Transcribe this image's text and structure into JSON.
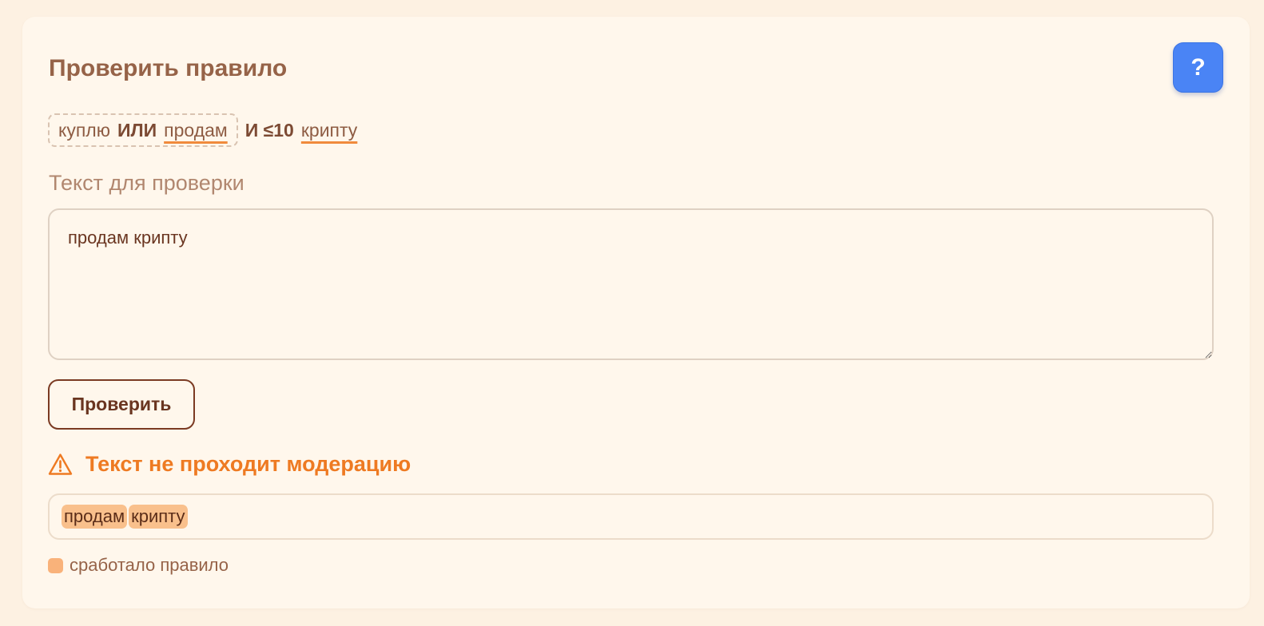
{
  "header": {
    "title": "Проверить правило",
    "help_label": "?"
  },
  "rule": {
    "group_word_1": "куплю",
    "group_operator": "ИЛИ",
    "group_word_2": "продам",
    "tail_operator": "И ≤10",
    "tail_word": "крипту"
  },
  "input": {
    "label": "Текст для проверки",
    "value": "продам крипту"
  },
  "actions": {
    "check_label": "Проверить"
  },
  "result": {
    "status_text": "Текст не проходит модерацию",
    "status_color": "#ee7a22",
    "highlighted_tokens": [
      "продам",
      "крипту"
    ],
    "highlight_color": "#f9c08c"
  },
  "legend": {
    "label": "сработало правило",
    "color": "#f9b27a"
  }
}
